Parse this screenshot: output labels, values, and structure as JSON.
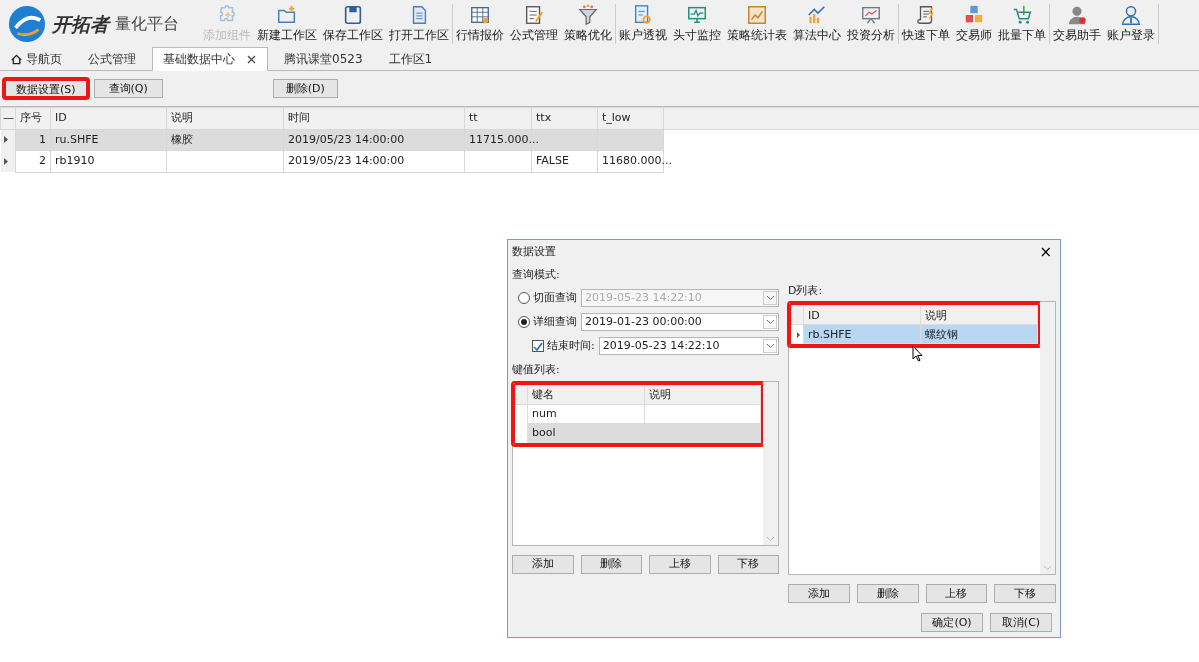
{
  "logo": {
    "brand": "开拓者",
    "product": "量化平台"
  },
  "toolbar_groups": [
    [
      {
        "label": "添加组件",
        "disabled": true
      },
      {
        "label": "新建工作区",
        "disabled": false
      },
      {
        "label": "保存工作区",
        "disabled": false
      },
      {
        "label": "打开工作区",
        "disabled": false
      }
    ],
    [
      {
        "label": "行情报价",
        "disabled": false
      },
      {
        "label": "公式管理",
        "disabled": false
      },
      {
        "label": "策略优化",
        "disabled": false
      }
    ],
    [
      {
        "label": "账户透视",
        "disabled": false
      },
      {
        "label": "头寸监控",
        "disabled": false
      },
      {
        "label": "策略统计表",
        "disabled": false
      },
      {
        "label": "算法中心",
        "disabled": false
      },
      {
        "label": "投资分析",
        "disabled": false
      }
    ],
    [
      {
        "label": "快速下单",
        "disabled": false
      },
      {
        "label": "交易师",
        "disabled": false
      },
      {
        "label": "批量下单",
        "disabled": false
      }
    ],
    [
      {
        "label": "交易助手",
        "disabled": false
      },
      {
        "label": "账户登录",
        "disabled": false
      }
    ]
  ],
  "tabs": [
    {
      "label": "导航页",
      "kind": "home",
      "selected": false,
      "closable": false
    },
    {
      "label": "公式管理",
      "kind": "plain",
      "selected": false,
      "closable": false
    },
    {
      "label": "基础数据中心",
      "kind": "plain",
      "selected": true,
      "closable": true
    },
    {
      "label": "腾讯课堂0523",
      "kind": "plain",
      "selected": false,
      "closable": false
    },
    {
      "label": "工作区1",
      "kind": "plain",
      "selected": false,
      "closable": false
    }
  ],
  "actions": [
    {
      "label": "数据设置(S)",
      "highlighted": true
    },
    {
      "label": "查询(Q)",
      "highlighted": false
    },
    {
      "label": "删除(D)",
      "highlighted": false
    }
  ],
  "table": {
    "collapse_mark": "—",
    "columns": [
      "序号",
      "ID",
      "说明",
      "时间",
      "tt",
      "ttx",
      "t_low"
    ],
    "rows": [
      {
        "selected": true,
        "cells": [
          "1",
          "ru.SHFE",
          "橡胶",
          "2019/05/23 14:00:00",
          "11715.000...",
          "",
          ""
        ]
      },
      {
        "selected": false,
        "cells": [
          "2",
          "rb1910",
          "",
          "2019/05/23 14:00:00",
          "",
          "FALSE",
          "11680.000..."
        ]
      }
    ]
  },
  "dialog": {
    "title": "数据设置",
    "close": "×",
    "mode_label": "查询模式:",
    "modes": [
      {
        "label": "切面查询",
        "selected": false,
        "value": "2019-05-23 14:22:10"
      },
      {
        "label": "详细查询",
        "selected": true,
        "value": "2019-01-23 00:00:00"
      }
    ],
    "end_time": {
      "label": "结束时间:",
      "checked": true,
      "value": "2019-05-23 14:22:10"
    },
    "key_list": {
      "label": "键值列表:",
      "highlighted": true,
      "columns": [
        "键名",
        "说明"
      ],
      "rows": [
        {
          "selected": false,
          "cells": [
            "num",
            ""
          ]
        },
        {
          "selected": true,
          "cells": [
            "bool",
            ""
          ]
        }
      ]
    },
    "id_list": {
      "label": "D列表:",
      "highlighted": true,
      "columns": [
        "ID",
        "说明"
      ],
      "rows": [
        {
          "selected": true,
          "cells": [
            "rb.SHFE",
            "螺纹钢"
          ]
        }
      ]
    },
    "key_buttons": [
      "添加",
      "删除",
      "上移",
      "下移"
    ],
    "id_buttons": [
      "添加",
      "删除",
      "上移",
      "下移"
    ],
    "footer_buttons": [
      "确定(O)",
      "取消(C)"
    ]
  }
}
